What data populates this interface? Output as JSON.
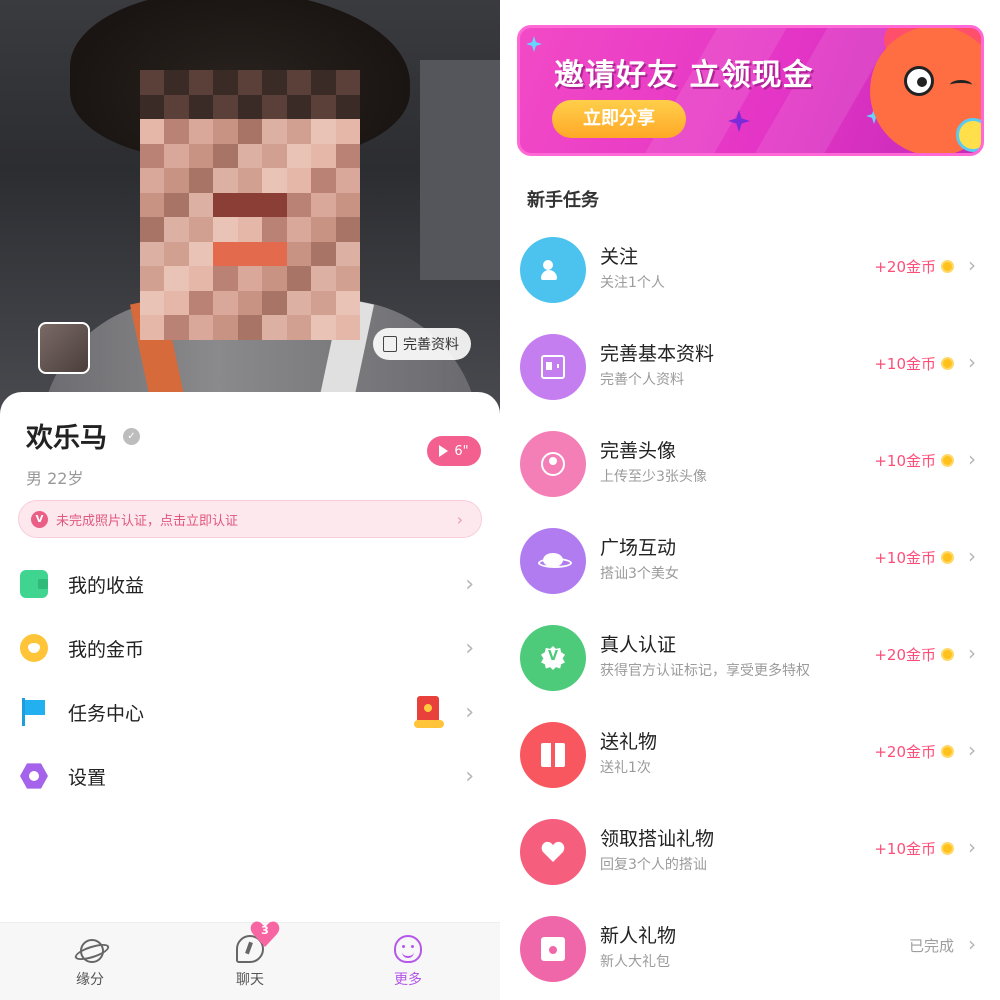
{
  "profile": {
    "complete_profile_label": "完善资料",
    "name": "欢乐马",
    "gender_age": "男  22岁",
    "video_count": "6\"",
    "photo_verify_text": "未完成照片认证，点击立即认证"
  },
  "menu": {
    "earnings": "我的收益",
    "coins": "我的金币",
    "tasks": "任务中心",
    "settings": "设置"
  },
  "tabbar": {
    "fate": "缘分",
    "chat": "聊天",
    "chat_badge": "3",
    "more": "更多",
    "active": "more"
  },
  "banner": {
    "title": "邀请好友 立领现金",
    "share_button": "立即分享"
  },
  "tasks_section": {
    "title": "新手任务",
    "items": [
      {
        "title": "关注",
        "subtitle": "关注1个人",
        "reward": "+20金币",
        "color": "#4cc3ef",
        "icon": "users-icon"
      },
      {
        "title": "完善基本资料",
        "subtitle": "完善个人资料",
        "reward": "+10金币",
        "color": "#c57ef0",
        "icon": "id-card-icon"
      },
      {
        "title": "完善头像",
        "subtitle": "上传至少3张头像",
        "reward": "+10金币",
        "color": "#f47fb6",
        "icon": "avatar-icon"
      },
      {
        "title": "广场互动",
        "subtitle": "搭讪3个美女",
        "reward": "+10金币",
        "color": "#b27cf1",
        "icon": "planet-icon"
      },
      {
        "title": "真人认证",
        "subtitle": "获得官方认证标记，享受更多特权",
        "reward": "+20金币",
        "color": "#4ecb7a",
        "icon": "verified-badge-icon"
      },
      {
        "title": "送礼物",
        "subtitle": "送礼1次",
        "reward": "+20金币",
        "color": "#f9575f",
        "icon": "gift-icon"
      },
      {
        "title": "领取搭讪礼物",
        "subtitle": "回复3个人的搭讪",
        "reward": "+10金币",
        "color": "#f55e7c",
        "icon": "heart-icon"
      },
      {
        "title": "新人礼物",
        "subtitle": "新人大礼包",
        "reward": "已完成",
        "color": "#ef67a8",
        "icon": "red-packet-icon"
      }
    ]
  },
  "colors": {
    "accent_pink": "#f35f8e",
    "reward_red": "#ff4d78",
    "active_tab": "#b557e8",
    "banner_bg": "#e435c6"
  }
}
